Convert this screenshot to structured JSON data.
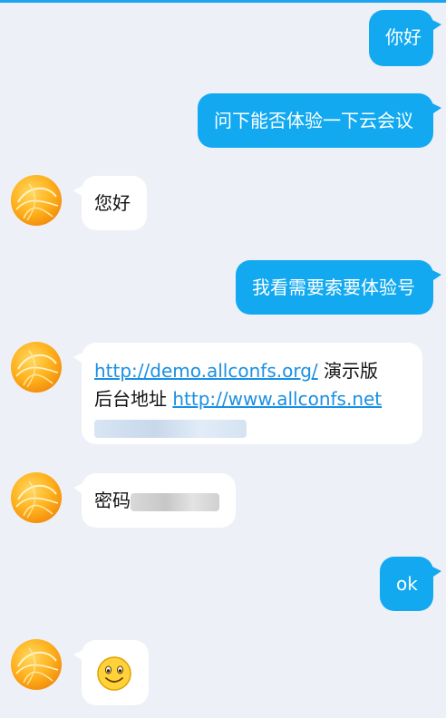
{
  "messages": {
    "m1": "你好",
    "m2": "问下能否体验一下云会议",
    "m3": "您好",
    "m4": "我看需要索要体验号",
    "m5": {
      "link1": "http://demo.allconfs.org/",
      "text1": " 演示版",
      "text2": "后台地址 ",
      "link2": "http://www.allconfs.net"
    },
    "m6": {
      "label": "密码"
    },
    "m7": "ok",
    "m8": {
      "emoji": "smiley-icon"
    }
  },
  "colors": {
    "outgoing_bubble": "#12a9f1",
    "incoming_bubble": "#ffffff",
    "background": "#eef0f7",
    "link": "#1a8fe3"
  }
}
